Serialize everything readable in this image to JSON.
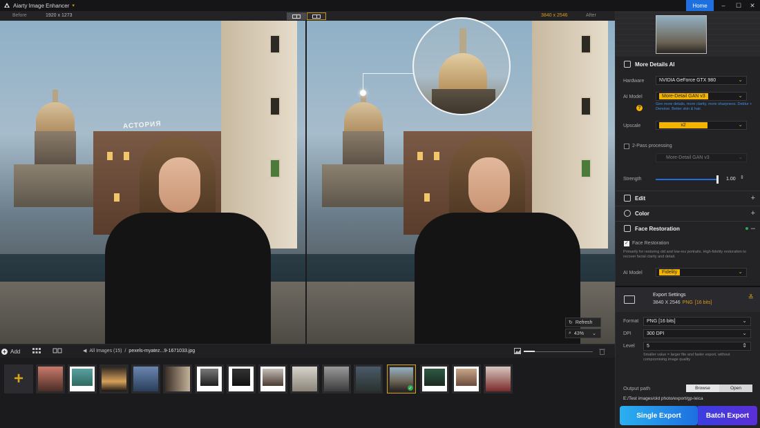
{
  "app": {
    "title": "Aiarty Image Enhancer",
    "home_label": "Home",
    "window_controls": {
      "minimize": "–",
      "maximize": "☐",
      "close": "✕"
    }
  },
  "compare": {
    "before_label": "Before",
    "after_label": "After",
    "original_size": "1920 x 1273",
    "output_size": "3840 x 2546",
    "sign_text": "АСТОРИЯ",
    "refresh_label": "Refresh",
    "zoom_level": "43%"
  },
  "filmstrip": {
    "add_label": "Add",
    "breadcrumb_all": "All Images (15)",
    "breadcrumb_sep": "/",
    "current_file": "pexels-myatez...9-1671033.jpg",
    "selected_index": 10
  },
  "panel": {
    "more_details": {
      "title": "More Details AI",
      "hardware_label": "Hardware",
      "hardware_value": "NVIDIA GeForce GTX 980",
      "ai_model_label": "AI Model",
      "ai_model_value": "More-Detail GAN  v3",
      "ai_model_note": "Gen more details, more clarity, more sharpness. Deblur + Denoise. Better skin & hair.",
      "upscale_label": "Upscale",
      "upscale_value": "x2",
      "two_pass_label": "2-Pass processing",
      "two_pass_model": "More-Detail GAN  v3",
      "strength_label": "Strength",
      "strength_value": "1.00"
    },
    "edit_label": "Edit",
    "color_label": "Color",
    "face_restoration": {
      "title": "Face Restoration",
      "checkbox_label": "Face Restoration",
      "description": "Primarily for restoring old and low-res portraits. High-fidelity restoration to recover facial clarity and detail.",
      "ai_model_label": "AI Model",
      "ai_model_value": "Fidelity"
    },
    "export": {
      "title": "Export Settings",
      "size": "3840 X 2546",
      "format_short": "PNG",
      "bits": "[16 bits]",
      "format_label": "Format",
      "format_value": "PNG   [16 bits]",
      "dpi_label": "DPI",
      "dpi_value": "300 DPI",
      "level_label": "Level",
      "level_value": "5",
      "level_note": "Smaller value = larger file and faster export, without compromising image quality",
      "output_label": "Output path",
      "browse_label": "Browse",
      "open_label": "Open",
      "output_path": "E:/Test images/old photo/export/gp-leica"
    },
    "single_export_label": "Single Export",
    "batch_export_label": "Batch Export"
  },
  "colors": {
    "accent_blue": "#1e6fe0",
    "accent_yellow": "#f4b400",
    "accent_orange": "#d99a1c"
  }
}
